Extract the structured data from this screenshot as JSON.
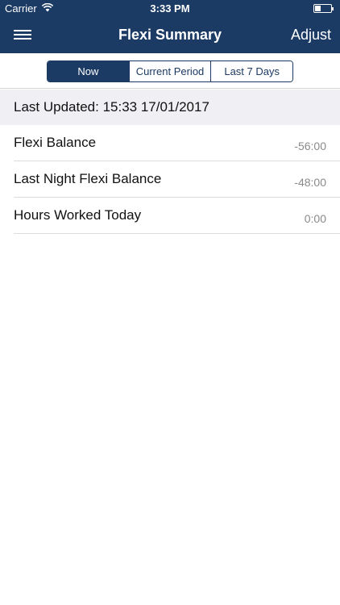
{
  "status_bar": {
    "carrier": "Carrier",
    "time": "3:33 PM"
  },
  "nav": {
    "title": "Flexi Summary",
    "adjust_label": "Adjust",
    "menu_icon": "hamburger-menu-icon"
  },
  "segments": {
    "items": [
      "Now",
      "Current Period",
      "Last 7 Days"
    ],
    "selected": "Now"
  },
  "last_updated": "Last Updated: 15:33 17/01/2017",
  "rows": [
    {
      "label": "Flexi Balance",
      "value": "-56:00"
    },
    {
      "label": "Last Night Flexi Balance",
      "value": "-48:00"
    },
    {
      "label": "Hours Worked Today",
      "value": "0:00"
    }
  ],
  "colors": {
    "brand": "#1b3a64",
    "section_background": "#efeff4",
    "value_text": "#8a8a8a"
  }
}
